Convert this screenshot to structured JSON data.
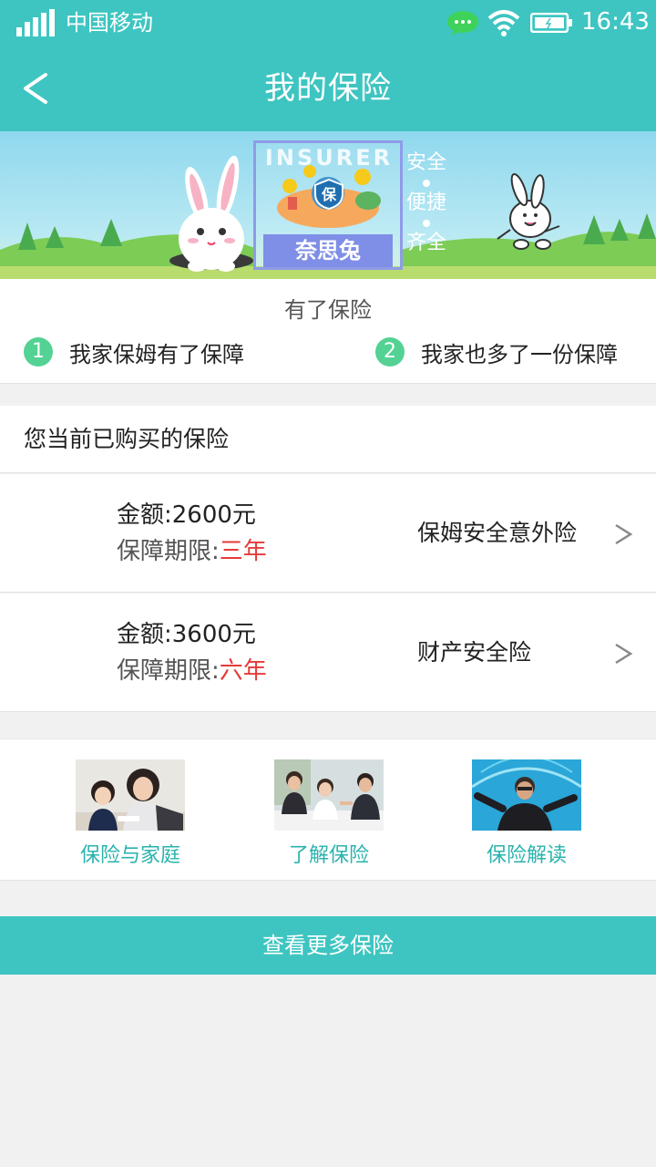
{
  "status_bar": {
    "carrier": "中国移动",
    "time": "16:43"
  },
  "nav": {
    "title": "我的保险"
  },
  "banner": {
    "brand_top": "INSURER",
    "brand_badge": "保",
    "brand_name": "奈思兔",
    "slogan": [
      "安全",
      "便捷",
      "齐全"
    ]
  },
  "intro": {
    "heading": "有了保险",
    "points": [
      {
        "num": "1",
        "text": "我家保姆有了保障"
      },
      {
        "num": "2",
        "text": "我家也多了一份保障"
      }
    ]
  },
  "purchased": {
    "title": "您当前已购买的保险",
    "policies": [
      {
        "amount": "金额:2600元",
        "term_label": "保障期限:",
        "term_value": "三年",
        "name": "保姆安全意外险"
      },
      {
        "amount": "金额:3600元",
        "term_label": "保障期限:",
        "term_value": "六年",
        "name": "财产安全险"
      }
    ]
  },
  "articles": [
    {
      "caption": "保险与家庭"
    },
    {
      "caption": "了解保险"
    },
    {
      "caption": "保险解读"
    }
  ],
  "more_button": "查看更多保险",
  "colors": {
    "accent": "#3ec5c1",
    "term_red": "#e63a3a",
    "step_green": "#53d293",
    "caption_teal": "#2ab3ad"
  }
}
